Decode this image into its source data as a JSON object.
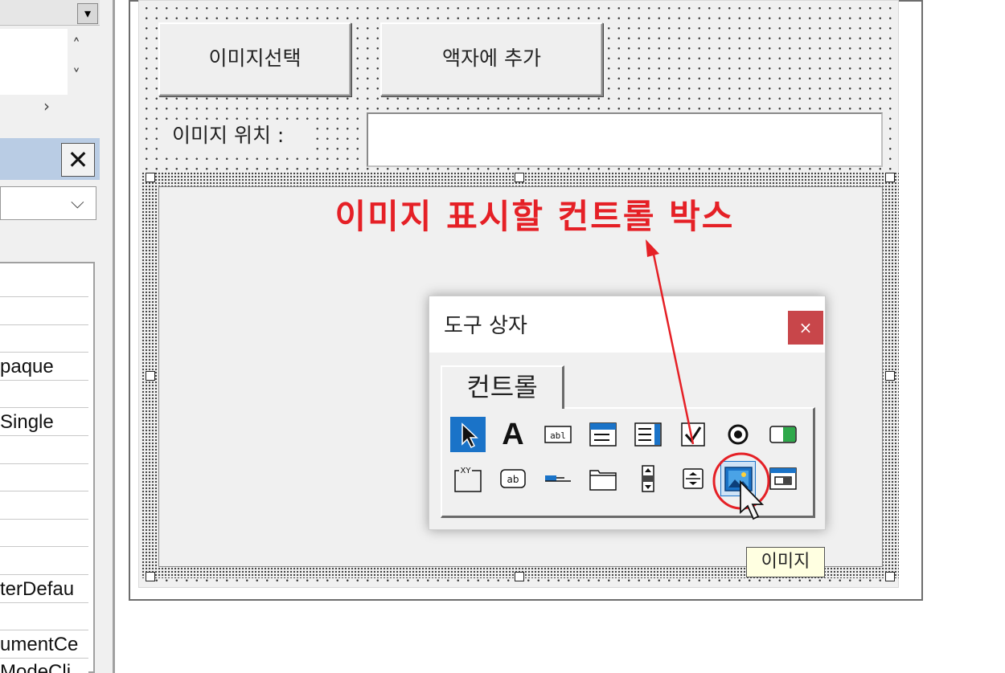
{
  "property_pane": {
    "values": [
      "",
      "",
      "",
      "paque",
      "",
      "Single",
      "",
      "",
      "",
      "",
      "",
      "terDefau",
      "",
      "umentCe",
      "ModeCli"
    ]
  },
  "form": {
    "buttons": {
      "select_image": "이미지선택",
      "add_to_frame": "액자에 추가"
    },
    "image_location_label": "이미지 위치 :",
    "image_location_value": ""
  },
  "annotation": {
    "text": "이미지 표시할 컨트롤 박스",
    "color": "#e52026"
  },
  "toolbox": {
    "title": "도구 상자",
    "close": "×",
    "tab": "컨트롤",
    "tools_row1": [
      "select-objects-icon",
      "label-icon",
      "textbox-icon",
      "combobox-icon",
      "listbox-icon",
      "checkbox-icon",
      "optionbutton-icon",
      "togglebutton-icon"
    ],
    "tools_row2": [
      "frame-icon",
      "commandbutton-icon",
      "tabstrip-icon",
      "multipage-icon",
      "scrollbar-icon",
      "spinbutton-icon",
      "image-icon",
      "refedit-icon"
    ]
  },
  "tooltip": {
    "text": "이미지"
  },
  "accent": "#1a73c8"
}
